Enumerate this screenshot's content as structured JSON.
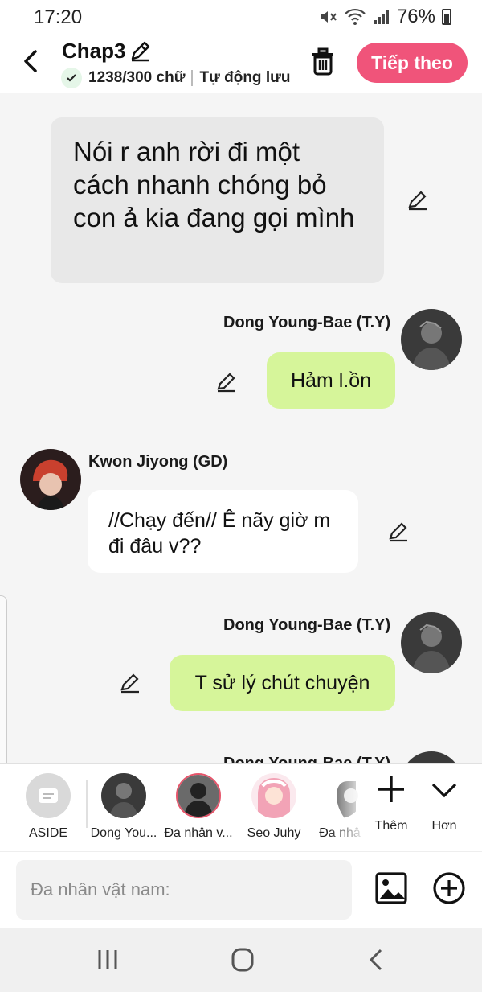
{
  "status_bar": {
    "time": "17:20",
    "battery": "76%"
  },
  "header": {
    "title": "Chap3",
    "word_count": "1238/300 chữ",
    "autosave": "Tự động lưu",
    "next_label": "Tiếp theo",
    "accent_color": "#f0547a"
  },
  "messages": [
    {
      "type": "narration",
      "text": "Nói r anh rời đi một cách nhanh chóng bỏ con ả kia đang gọi mình"
    },
    {
      "type": "right",
      "speaker": "Dong Young-Bae (T.Y)",
      "text": "Hảm l.ồn"
    },
    {
      "type": "left",
      "speaker": "Kwon Jiyong (GD)",
      "text": "//Chạy đến// Ê nãy giờ m đi đâu v??"
    },
    {
      "type": "right",
      "speaker": "Dong Young-Bae (T.Y)",
      "text": "T sử lý chút chuyện"
    },
    {
      "type": "right",
      "speaker": "Dong Young-Bae (T.Y)",
      "text": ""
    }
  ],
  "characters": [
    {
      "label": "ASIDE"
    },
    {
      "label": "Dong You..."
    },
    {
      "label": "Đa nhân v..."
    },
    {
      "label": "Seo Juhy"
    },
    {
      "label": "Đa nhâ"
    }
  ],
  "actions": {
    "add_label": "Thêm",
    "more_label": "Hơn"
  },
  "composer": {
    "placeholder": "Đa nhân vật nam:"
  },
  "icons": [
    "mute-icon",
    "wifi-icon",
    "signal-icon",
    "battery-icon",
    "back-icon",
    "pencil-icon",
    "check-icon",
    "trash-icon",
    "image-icon",
    "add-circle-icon",
    "recents-icon",
    "home-icon",
    "nav-back-icon"
  ]
}
